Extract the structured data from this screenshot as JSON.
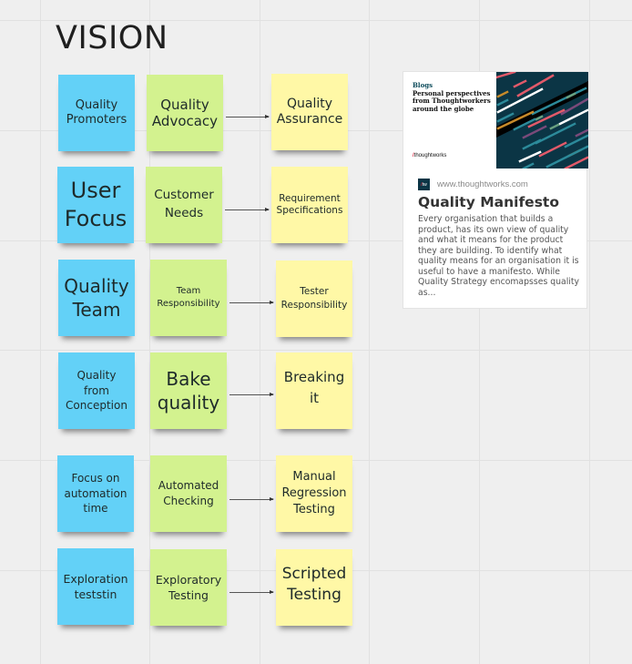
{
  "board": {
    "title": "VISION",
    "colors": {
      "blue": "#63d1f7",
      "green": "#d3f28f",
      "yellow": "#fff8a6",
      "background": "#efefef"
    },
    "rows": [
      {
        "blue": [
          "Quality",
          "Promoters"
        ],
        "green": [
          "Quality",
          "Advocacy"
        ],
        "yellow": [
          "Quality",
          "Assurance"
        ]
      },
      {
        "blue": [
          "User",
          "Focus"
        ],
        "green": [
          "Customer",
          "Needs"
        ],
        "yellow": [
          "Requirement",
          "Specifications"
        ]
      },
      {
        "blue": [
          "Quality",
          "Team"
        ],
        "green": [
          "Team",
          "Responsibility"
        ],
        "yellow": [
          "Tester",
          "Responsibility"
        ]
      },
      {
        "blue": [
          "Quality",
          "from",
          "Conception"
        ],
        "green": [
          "Bake",
          "quality"
        ],
        "yellow": [
          "Breaking",
          "it"
        ]
      },
      {
        "blue": [
          "Focus on",
          "automation",
          "time"
        ],
        "green": [
          "Automated",
          "Checking"
        ],
        "yellow": [
          "Manual",
          "Regression",
          "Testing"
        ]
      },
      {
        "blue": [
          "Exploration",
          "teststin"
        ],
        "green": [
          "Exploratory",
          "Testing"
        ],
        "yellow": [
          "Scripted",
          "Testing"
        ]
      }
    ]
  },
  "link_card": {
    "banner_kicker": "Blogs",
    "banner_headline": "Personal perspectives from Thoughtworkers around the globe",
    "banner_logo_slash": "/",
    "banner_logo_text": "thoughtworks",
    "favicon_text": "tw",
    "source": "www.thoughtworks.com",
    "title": "Quality Manifesto",
    "description": "Every organisation that builds a product, has its own view of quality and what it means for the product they are building. To identify what quality means for an organisation it is useful to have a manifesto. While Quality Strategy encomapsses quality as..."
  }
}
